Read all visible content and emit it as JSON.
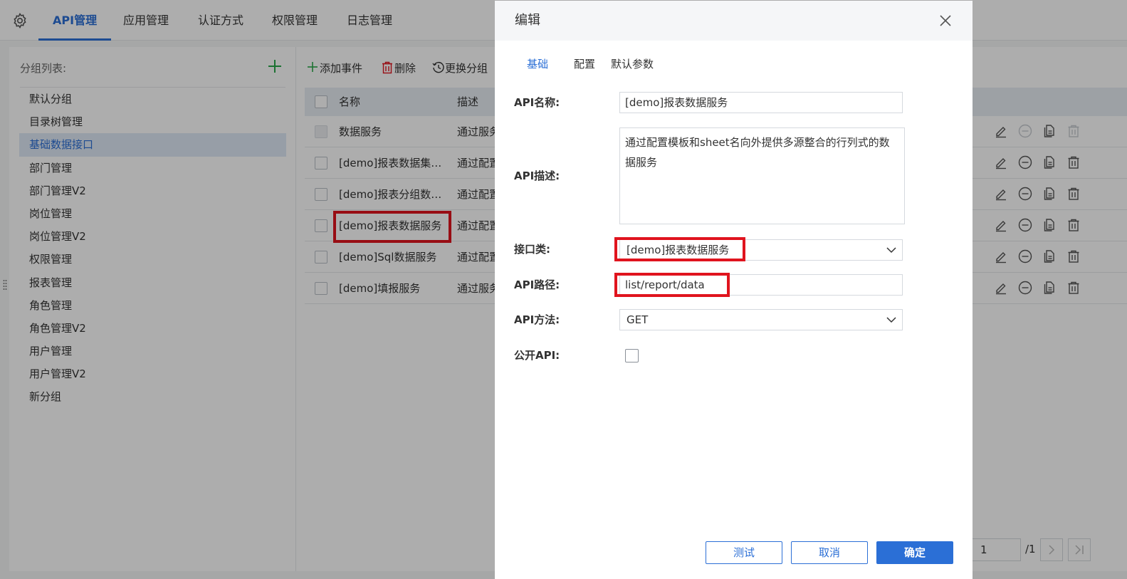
{
  "nav": {
    "settings_icon": "gear-icon",
    "tabs": [
      {
        "label": "API管理",
        "active": true
      },
      {
        "label": "应用管理",
        "active": false
      },
      {
        "label": "认证方式",
        "active": false
      },
      {
        "label": "权限管理",
        "active": false
      },
      {
        "label": "日志管理",
        "active": false
      }
    ]
  },
  "sidebar": {
    "title": "分组列表:",
    "add_icon": "plus-icon",
    "groups": [
      {
        "label": "默认分组",
        "selected": false
      },
      {
        "label": "目录树管理",
        "selected": false
      },
      {
        "label": "基础数据接口",
        "selected": true
      },
      {
        "label": "部门管理",
        "selected": false
      },
      {
        "label": "部门管理V2",
        "selected": false
      },
      {
        "label": "岗位管理",
        "selected": false
      },
      {
        "label": "岗位管理V2",
        "selected": false
      },
      {
        "label": "权限管理",
        "selected": false
      },
      {
        "label": "报表管理",
        "selected": false
      },
      {
        "label": "角色管理",
        "selected": false
      },
      {
        "label": "角色管理V2",
        "selected": false
      },
      {
        "label": "用户管理",
        "selected": false
      },
      {
        "label": "用户管理V2",
        "selected": false
      },
      {
        "label": "新分组",
        "selected": false
      }
    ]
  },
  "toolbar": {
    "add_label": "添加事件",
    "delete_label": "删除",
    "change_group_label": "更换分组"
  },
  "table": {
    "headers": {
      "name": "名称",
      "desc": "描述"
    },
    "rows": [
      {
        "name": "数据服务",
        "desc": "通过服务",
        "disabled": true
      },
      {
        "name": "[demo]报表数据集服务",
        "desc": "通过配置",
        "disabled": false
      },
      {
        "name": "[demo]报表分组数据服务",
        "desc": "通过配置",
        "disabled": false
      },
      {
        "name": "[demo]报表数据服务",
        "desc": "通过配置",
        "disabled": false
      },
      {
        "name": "[demo]Sql数据服务",
        "desc": "通过配置",
        "disabled": false
      },
      {
        "name": "[demo]填报服务",
        "desc": "通过服务",
        "disabled": false
      }
    ]
  },
  "pager": {
    "page": "1",
    "total": "/1"
  },
  "modal": {
    "title": "编辑",
    "tabs": [
      "基础",
      "配置",
      "默认参数"
    ],
    "fields": {
      "name_label": "API名称:",
      "name_value": "[demo]报表数据服务",
      "desc_label": "API描述:",
      "desc_value": "通过配置模板和sheet名向外提供多源整合的行列式的数据服务",
      "class_label": "接口类:",
      "class_value": "[demo]报表数据服务",
      "path_label": "API路径:",
      "path_value": "list/report/data",
      "method_label": "API方法:",
      "method_value": "GET",
      "public_label": "公开API:",
      "public_checked": false
    },
    "buttons": {
      "test": "测试",
      "cancel": "取消",
      "ok": "确定"
    }
  },
  "colors": {
    "accent": "#2b6fd6",
    "highlight": "#e0141e",
    "add_green": "#2aa84a"
  }
}
